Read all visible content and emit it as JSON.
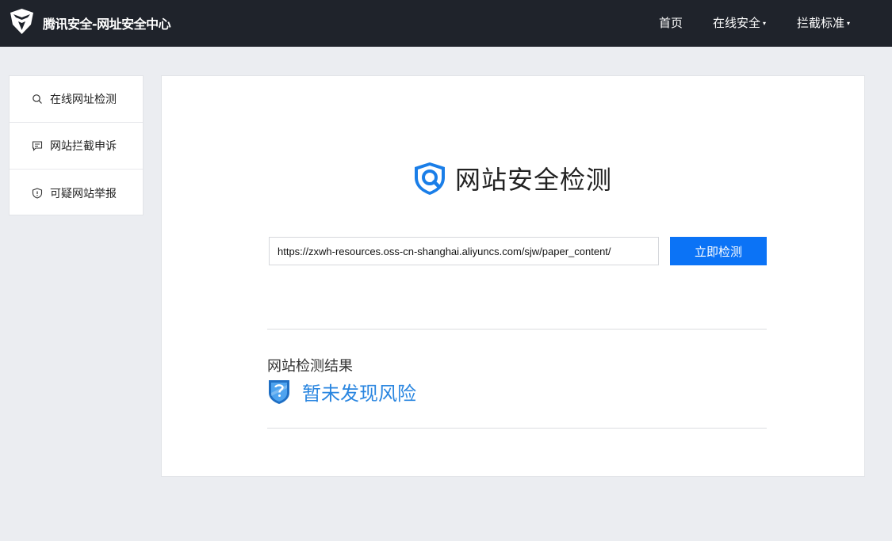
{
  "header": {
    "site_title": "腾讯安全-网址安全中心",
    "logo_icon": "tencent-security-logo",
    "nav": [
      {
        "label": "首页",
        "has_caret": false
      },
      {
        "label": "在线安全",
        "has_caret": true
      },
      {
        "label": "拦截标准",
        "has_caret": true
      }
    ],
    "caret": "▾"
  },
  "sidebar": {
    "items": [
      {
        "label": "在线网址检测",
        "icon": "search-icon"
      },
      {
        "label": "网站拦截申诉",
        "icon": "chat-icon"
      },
      {
        "label": "可疑网站举报",
        "icon": "shield-alert-icon"
      }
    ]
  },
  "main": {
    "title": "网站安全检测",
    "title_icon": "shield-search-icon",
    "url_value": "https://zxwh-resources.oss-cn-shanghai.aliyuncs.com/sjw/paper_content/",
    "check_button": "立即检测",
    "result_heading": "网站检测结果",
    "result_text": "暂未发现风险",
    "result_icon": "shield-question-icon"
  },
  "colors": {
    "header_bg": "#1f232b",
    "page_bg": "#ebedf1",
    "accent": "#0b73f6",
    "result_blue": "#2a86e0"
  }
}
